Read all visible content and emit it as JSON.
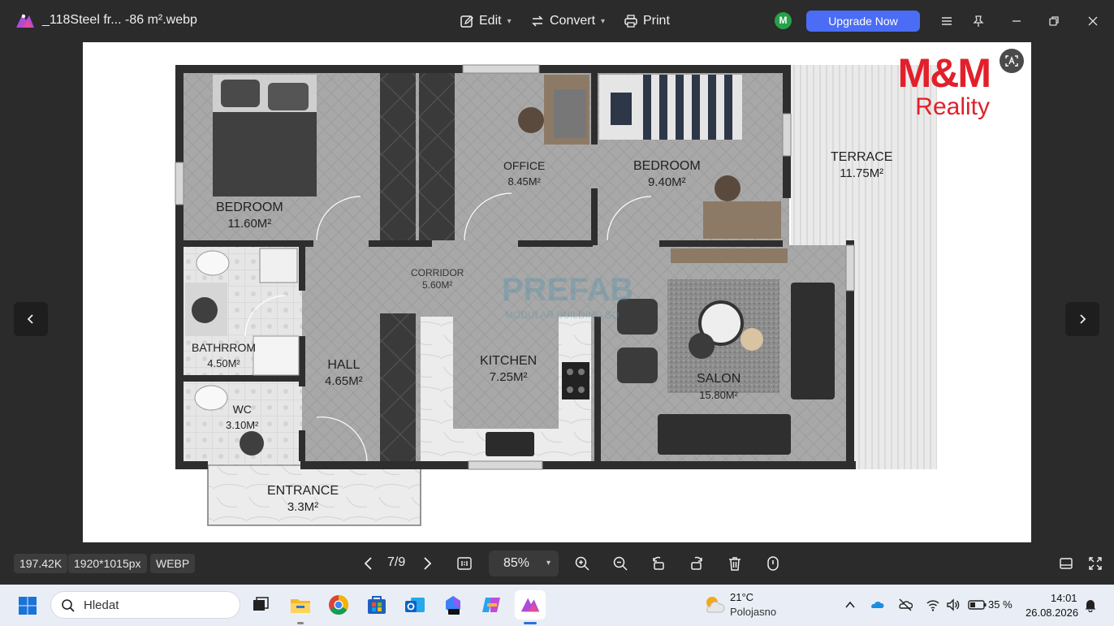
{
  "window": {
    "file_title": "_118Steel fr... -86 m².webp",
    "menu": {
      "edit": "Edit",
      "convert": "Convert",
      "print": "Print"
    },
    "avatar_initial": "M",
    "upgrade_label": "Upgrade Now"
  },
  "floorplan": {
    "brand_top": "M&M",
    "brand_sub": "Reality",
    "watermark": "PREFAB",
    "watermark_sub": "MODULAR BUILDING SO",
    "rooms": {
      "bedroom1": {
        "name": "BEDROOM",
        "area": "11.60M²"
      },
      "office": {
        "name": "OFFICE",
        "area": "8.45M²"
      },
      "bedroom2": {
        "name": "BEDROOM",
        "area": "9.40M²"
      },
      "terrace": {
        "name": "TERRACE",
        "area": "11.75M²"
      },
      "corridor": {
        "name": "CORRIDOR",
        "area": "5.60M²"
      },
      "bathroom": {
        "name": "BATHRROM",
        "area": "4.50M²"
      },
      "hall": {
        "name": "HALL",
        "area": "4.65M²"
      },
      "kitchen": {
        "name": "KITCHEN",
        "area": "7.25M²"
      },
      "salon": {
        "name": "SALON",
        "area": "15.80M²"
      },
      "wc": {
        "name": "WC",
        "area": "3.10M²"
      },
      "entrance": {
        "name": "ENTRANCE",
        "area": "3.3M²"
      }
    }
  },
  "statusbar": {
    "file_size": "197.42K",
    "dimensions": "1920*1015px",
    "format": "WEBP",
    "page": "7/9",
    "zoom": "85%"
  },
  "taskbar": {
    "search_placeholder": "Hledat",
    "weather_temp": "21°C",
    "weather_desc": "Polojasno",
    "battery": "35 %",
    "time": "14:01",
    "date": "26.08.2026"
  },
  "colors": {
    "accent": "#4b6cf5",
    "brand_red": "#e2202a",
    "wall": "#2e2e2e",
    "floor": "#a9a9a9"
  }
}
